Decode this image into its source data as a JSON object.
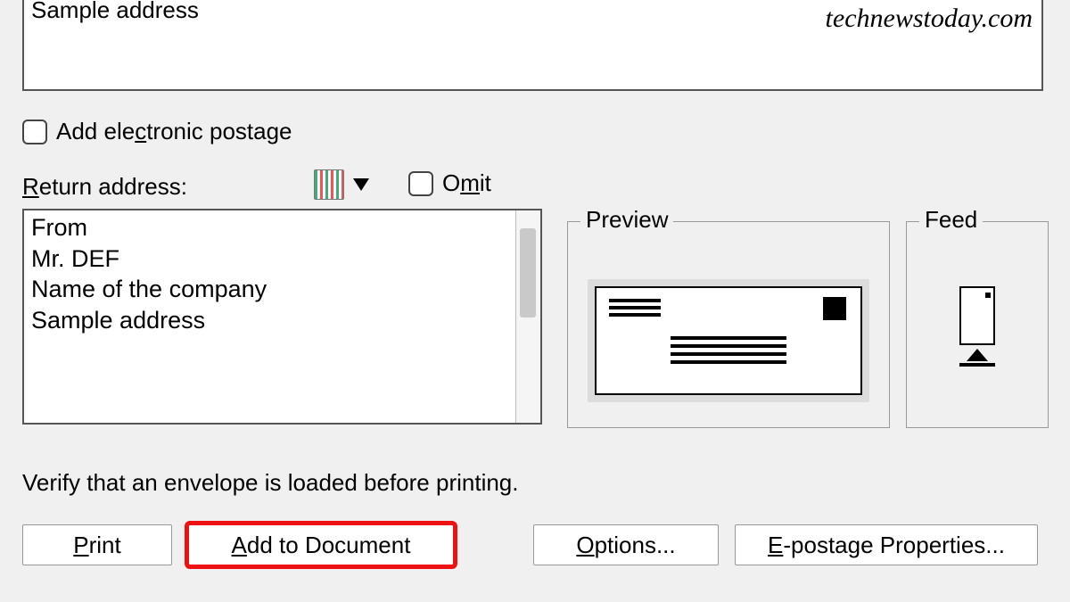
{
  "watermark": "technewstoday.com",
  "sample_address_label": "Sample address",
  "electronic_postage_label": "Add electronic postage",
  "return_address_label": "Return address:",
  "omit_label": "Omit",
  "return_address_value": "From\nMr. DEF\nName of the company\nSample address",
  "preview_legend": "Preview",
  "feed_legend": "Feed",
  "verify_text": "Verify that an envelope is loaded before printing.",
  "buttons": {
    "print": "Print",
    "add_to_document": "Add to Document",
    "options": "Options...",
    "epostage": "E-postage Properties..."
  }
}
